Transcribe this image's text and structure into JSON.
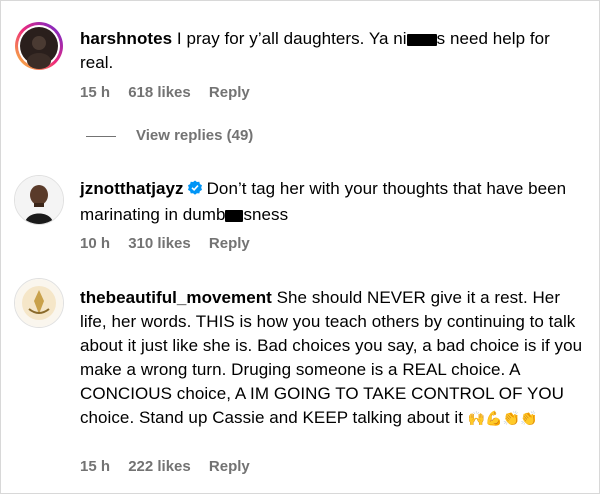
{
  "comments": [
    {
      "username": "harshnotes",
      "text_before": "I pray for y’all daughters. Ya ni",
      "text_after": "s need help for real.",
      "time": "15 h",
      "likes": "618 likes",
      "reply": "Reply",
      "view_replies": "View replies (49)",
      "avatar_icon": "user-avatar-dark"
    },
    {
      "username": "jznotthatjayz",
      "verified_icon": "verified-badge-icon",
      "text_before": "Don’t tag her with your thoughts that have been marinating in dumb",
      "text_after": "sness",
      "time": "10 h",
      "likes": "310 likes",
      "reply": "Reply",
      "avatar_icon": "user-avatar-man"
    },
    {
      "username": "thebeautiful_movement",
      "text": "She should NEVER give it a rest. Her life, her words. THIS is how you teach others by continuing to talk about it just like she is. Bad choices you say, a bad choice is if you make a wrong turn. Druging someone is a REAL choice. A CONCIOUS choice, A IM GOING TO TAKE CONTROL OF YOU choice. Stand up Cassie and KEEP talking about it",
      "emojis": "🙌💪👏👏",
      "time": "15 h",
      "likes": "222 likes",
      "reply": "Reply",
      "avatar_icon": "user-avatar-logo"
    }
  ],
  "colors": {
    "meta": "#737373",
    "verified": "#0095f6",
    "story_ring_start": "#f9ce34",
    "story_ring_end": "#c13584"
  }
}
